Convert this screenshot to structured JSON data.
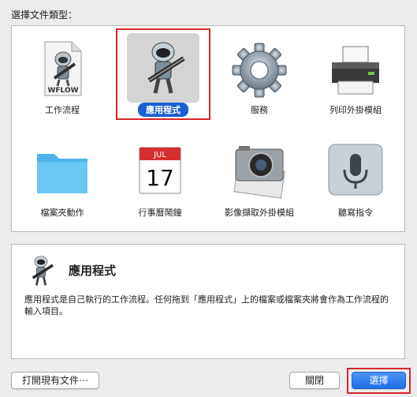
{
  "prompt_label": "選擇文件類型：",
  "doc_types": [
    {
      "label": "工作流程",
      "icon": "workflow-file-icon",
      "badge": "WFLOW"
    },
    {
      "label": "應用程式",
      "icon": "automator-robot-icon",
      "selected": true
    },
    {
      "label": "服務",
      "icon": "gear-icon"
    },
    {
      "label": "列印外掛模組",
      "icon": "printer-icon"
    },
    {
      "label": "檔案夾動作",
      "icon": "folder-icon"
    },
    {
      "label": "行事曆鬧鐘",
      "icon": "calendar-icon",
      "month": "JUL",
      "day": "17"
    },
    {
      "label": "影像擷取外掛模組",
      "icon": "camera-icon"
    },
    {
      "label": "聽寫指令",
      "icon": "microphone-icon"
    }
  ],
  "description": {
    "title": "應用程式",
    "text": "應用程式是自己執行的工作流程。任何拖到「應用程式」上的檔案或檔案夾將會作為工作流程的輸入項目。",
    "icon": "automator-robot-icon"
  },
  "buttons": {
    "open_existing": "打開現有文件⋯",
    "close": "關閉",
    "choose": "選擇"
  },
  "colors": {
    "accent": "#1a5fd4",
    "highlight": "#d6262b",
    "background": "#ececec"
  }
}
